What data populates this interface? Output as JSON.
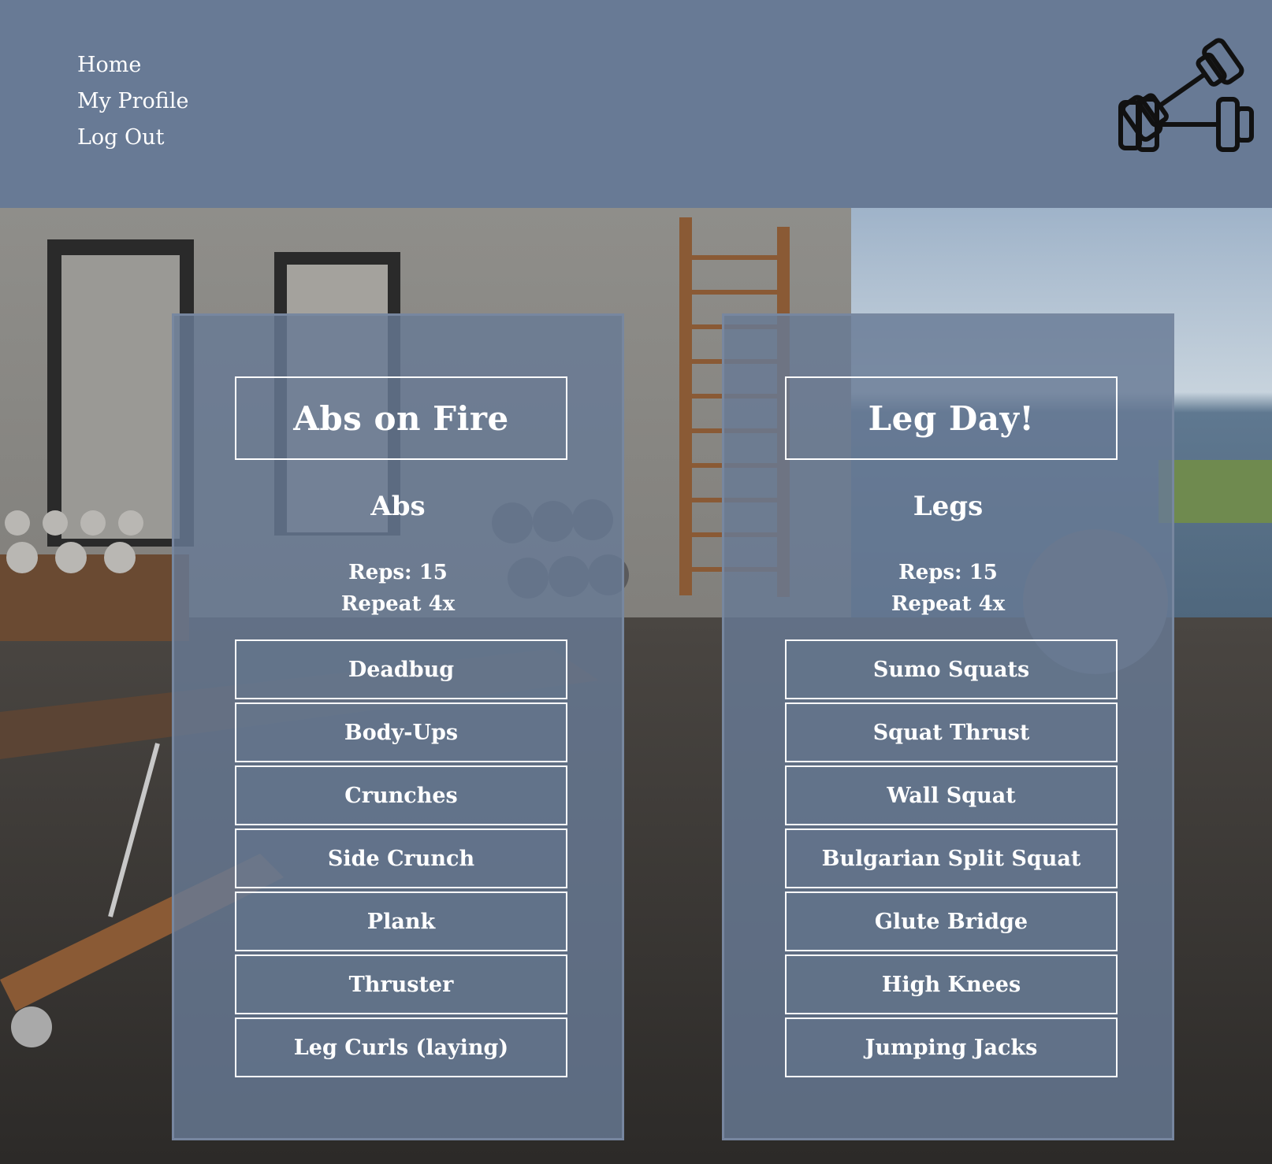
{
  "nav": {
    "items": [
      "Home",
      "My Profile",
      "Log Out"
    ]
  },
  "logo": {
    "icon": "dumbbells-icon"
  },
  "workouts": [
    {
      "title": "Abs on Fire",
      "category": "Abs",
      "reps": "Reps: 15",
      "repeat": "Repeat 4x",
      "exercises": [
        "Deadbug",
        "Body-Ups",
        "Crunches",
        "Side Crunch",
        "Plank",
        "Thruster",
        "Leg Curls (laying)"
      ]
    },
    {
      "title": "Leg Day!",
      "category": "Legs",
      "reps": "Reps: 15",
      "repeat": "Repeat 4x",
      "exercises": [
        "Sumo Squats",
        "Squat Thrust",
        "Wall Squat",
        "Bulgarian Split Squat",
        "Glute Bridge",
        "High Knees",
        "Jumping Jacks"
      ]
    }
  ],
  "colors": {
    "header_bg": "#687a95",
    "card_bg": "#687a95",
    "text": "#ffffff"
  }
}
